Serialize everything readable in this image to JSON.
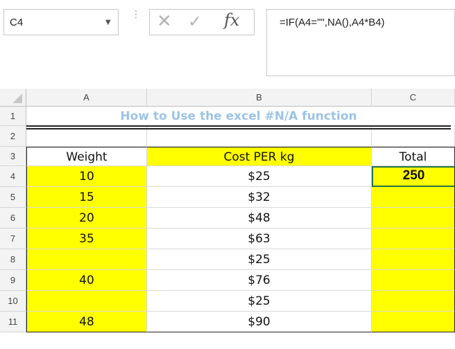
{
  "formula_bar": {
    "name_box": "C4",
    "formula": "=IF(A4=\"\",NA(),A4*B4)",
    "cancel_glyph": "✕",
    "enter_glyph": "✓",
    "fx_glyph": "fx"
  },
  "columns": [
    "A",
    "B",
    "C"
  ],
  "rows": [
    "1",
    "2",
    "3",
    "4",
    "5",
    "6",
    "7",
    "8",
    "9",
    "10",
    "11"
  ],
  "sheet": {
    "title": "How to Use the excel #N/A function",
    "headers": {
      "weight": "Weight",
      "cost": "Cost PER kg",
      "total": "Total"
    },
    "data": [
      {
        "weight": "10",
        "cost": "$25",
        "total": "250"
      },
      {
        "weight": "15",
        "cost": "$32",
        "total": ""
      },
      {
        "weight": "20",
        "cost": "$48",
        "total": ""
      },
      {
        "weight": "35",
        "cost": "$63",
        "total": ""
      },
      {
        "weight": "",
        "cost": "$25",
        "total": ""
      },
      {
        "weight": "40",
        "cost": "$76",
        "total": ""
      },
      {
        "weight": "",
        "cost": "$25",
        "total": ""
      },
      {
        "weight": "48",
        "cost": "$90",
        "total": ""
      }
    ]
  },
  "colors": {
    "highlight": "#ffff00",
    "title_text": "#9dc3e6",
    "selection": "#217346"
  }
}
